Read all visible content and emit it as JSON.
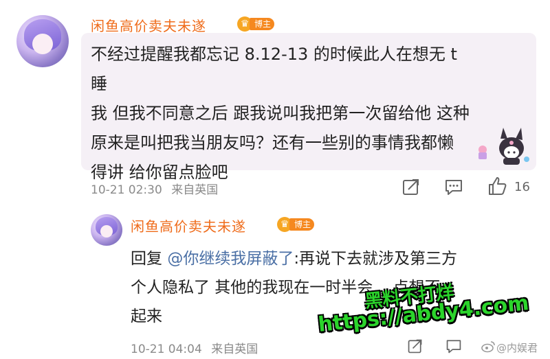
{
  "comment": {
    "username": "闲鱼高价卖夫未遂",
    "badge": "博主",
    "lines": [
      "不经过提醒我都忘记 8.12-13 的时候此人在想无 t 睡",
      "我 但我不同意之后 跟我说叫我把第一次留给他 这种",
      "原来是叫把我当朋友吗？还有一些别的事情我都懒",
      "得讲 给你留点脸吧"
    ],
    "timestamp": "10-21 02:30",
    "location": "来自英国",
    "likes": "16"
  },
  "reply": {
    "username": "闲鱼高价卖夫未遂",
    "badge": "博主",
    "prefix": "回复 ",
    "mention": "@你继续我屏蔽了",
    "lines": [
      ":再说下去就涉及第三方",
      "个人隐私了 其他的我现在一时半会 ...点想不",
      "起来"
    ],
    "timestamp": "10-21 04:04",
    "location": "来自英国"
  },
  "watermark": {
    "line1": "黑料不打烊",
    "line2": "https://abdy4.com",
    "color": "#2bd42b"
  },
  "credit": "@内娱君",
  "colors": {
    "username": "#ef6b1a",
    "badge": "#f5881f",
    "bubble": "#f5f0f6",
    "mention": "#4a6fa5"
  },
  "icons": [
    "share-icon",
    "comment-icon",
    "like-icon",
    "weibo-icon"
  ]
}
